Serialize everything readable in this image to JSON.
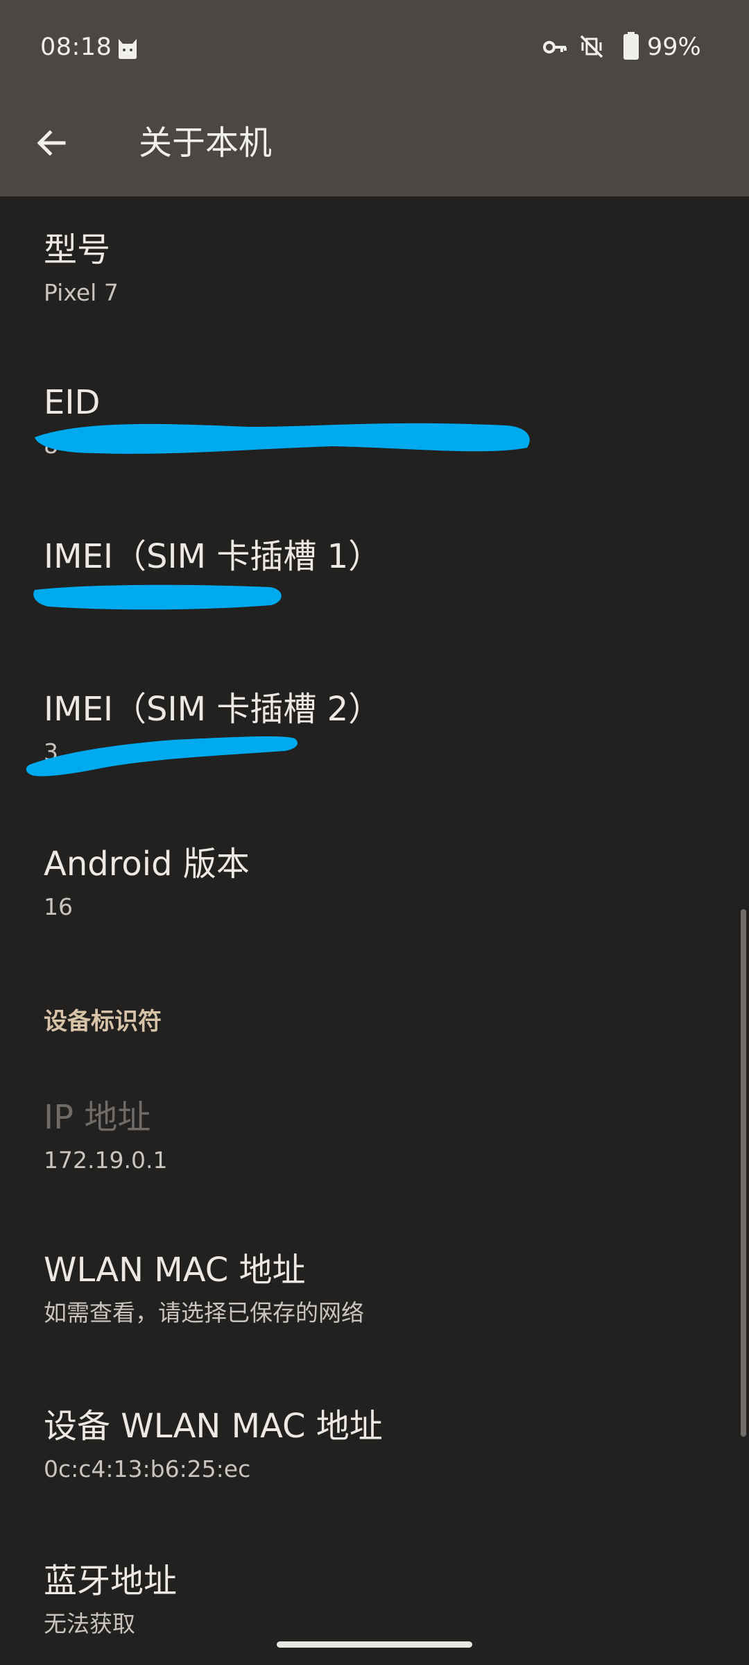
{
  "status_bar": {
    "time": "08:18",
    "battery_percent": "99%",
    "icons": [
      "cat-notification-icon",
      "vpn-key-icon",
      "vibrate-off-icon",
      "battery-icon"
    ]
  },
  "header": {
    "back_icon": "arrow-left-icon",
    "title": "关于本机"
  },
  "items": [
    {
      "title": "型号",
      "summary": "Pixel 7"
    },
    {
      "title": "EID",
      "summary": "8"
    },
    {
      "title": "IMEI（SIM 卡插槽 1）",
      "summary": ""
    },
    {
      "title": "IMEI（SIM 卡插槽 2）",
      "summary": "3"
    },
    {
      "title": "Android 版本",
      "summary": "16"
    }
  ],
  "section": {
    "title": "设备标识符"
  },
  "items2": [
    {
      "title": "IP 地址",
      "summary": "172.19.0.1"
    },
    {
      "title": "WLAN MAC 地址",
      "summary": "如需查看，请选择已保存的网络"
    },
    {
      "title": "设备 WLAN MAC 地址",
      "summary": "0c:c4:13:b6:25:ec"
    },
    {
      "title": "蓝牙地址",
      "summary": "无法获取"
    }
  ],
  "colors": {
    "header_bg": "#4a4745",
    "page_bg": "#222120",
    "section_accent": "#d7c3a8",
    "redaction": "#00aaee"
  }
}
